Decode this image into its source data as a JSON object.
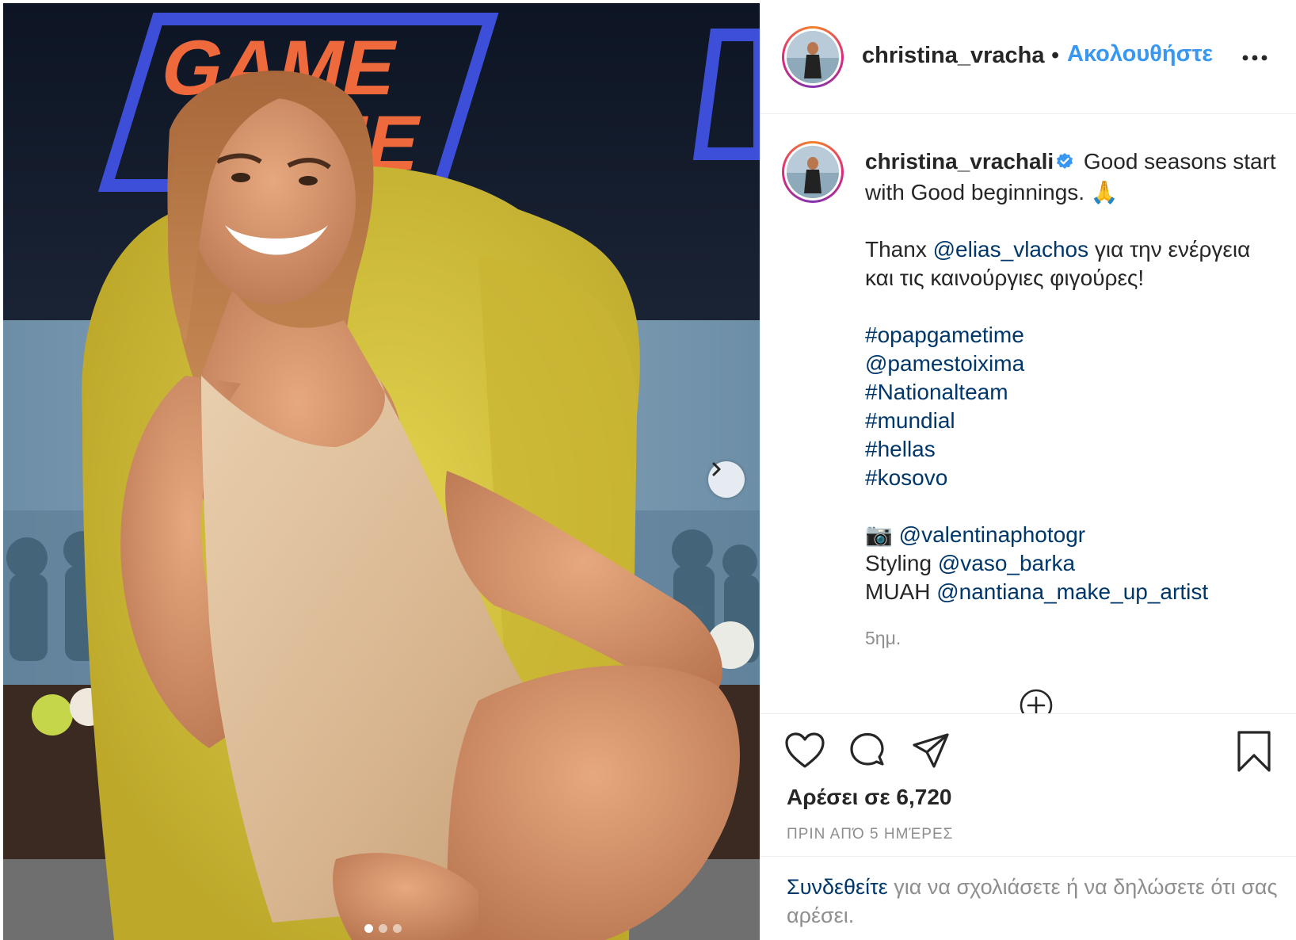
{
  "post": {
    "header": {
      "username": "christina_vracha",
      "separator": "•",
      "follow_label": "Ακολουθήστε",
      "more_icon": "more-dots-icon"
    },
    "media": {
      "carousel_count": 3,
      "active_index": 0,
      "next_icon": "chevron-right-icon",
      "backdrop_text": "GAME TIME"
    },
    "caption": {
      "username": "christina_vrachali",
      "verified_icon": "verified-badge-icon",
      "line1": "Good seasons start with Good beginnings. 🙏",
      "thanks_prefix": "Thanx ",
      "thanks_mention": "@elias_vlachos",
      "thanks_suffix": " για την ενέργεια και τις καινούργιες φιγούρες!",
      "tags": [
        "#opapgametime",
        "@pamestoixima",
        "#Nationalteam",
        "#mundial",
        "#hellas",
        "#kosovo"
      ],
      "camera_emoji": "📷",
      "photo_mention": "@valentinaphotogr",
      "styling_prefix": "Styling ",
      "styling_mention": "@vaso_barka",
      "muah_prefix": "MUAH ",
      "muah_mention": "@nantiana_make_up_artist",
      "time": "5ημ.",
      "load_more_icon": "plus-circle-icon"
    },
    "actions": {
      "like_icon": "heart-icon",
      "comment_icon": "comment-icon",
      "share_icon": "paper-plane-icon",
      "save_icon": "bookmark-icon"
    },
    "likes_text": "Αρέσει σε 6,720",
    "timestamp": "ΠΡΙΝ ΑΠΌ 5 ΗΜΈΡΕΣ",
    "login_prompt": {
      "link": "Συνδεθείτε",
      "text": " για να σχολιάσετε ή να δηλώσετε ότι σας αρέσει."
    },
    "colors": {
      "link_blue": "#3897f0",
      "mention_blue": "#00376b",
      "muted_gray": "#8e8e8e",
      "chair_yellow": "#d6c43a",
      "backdrop_orange": "#e8603a"
    }
  }
}
